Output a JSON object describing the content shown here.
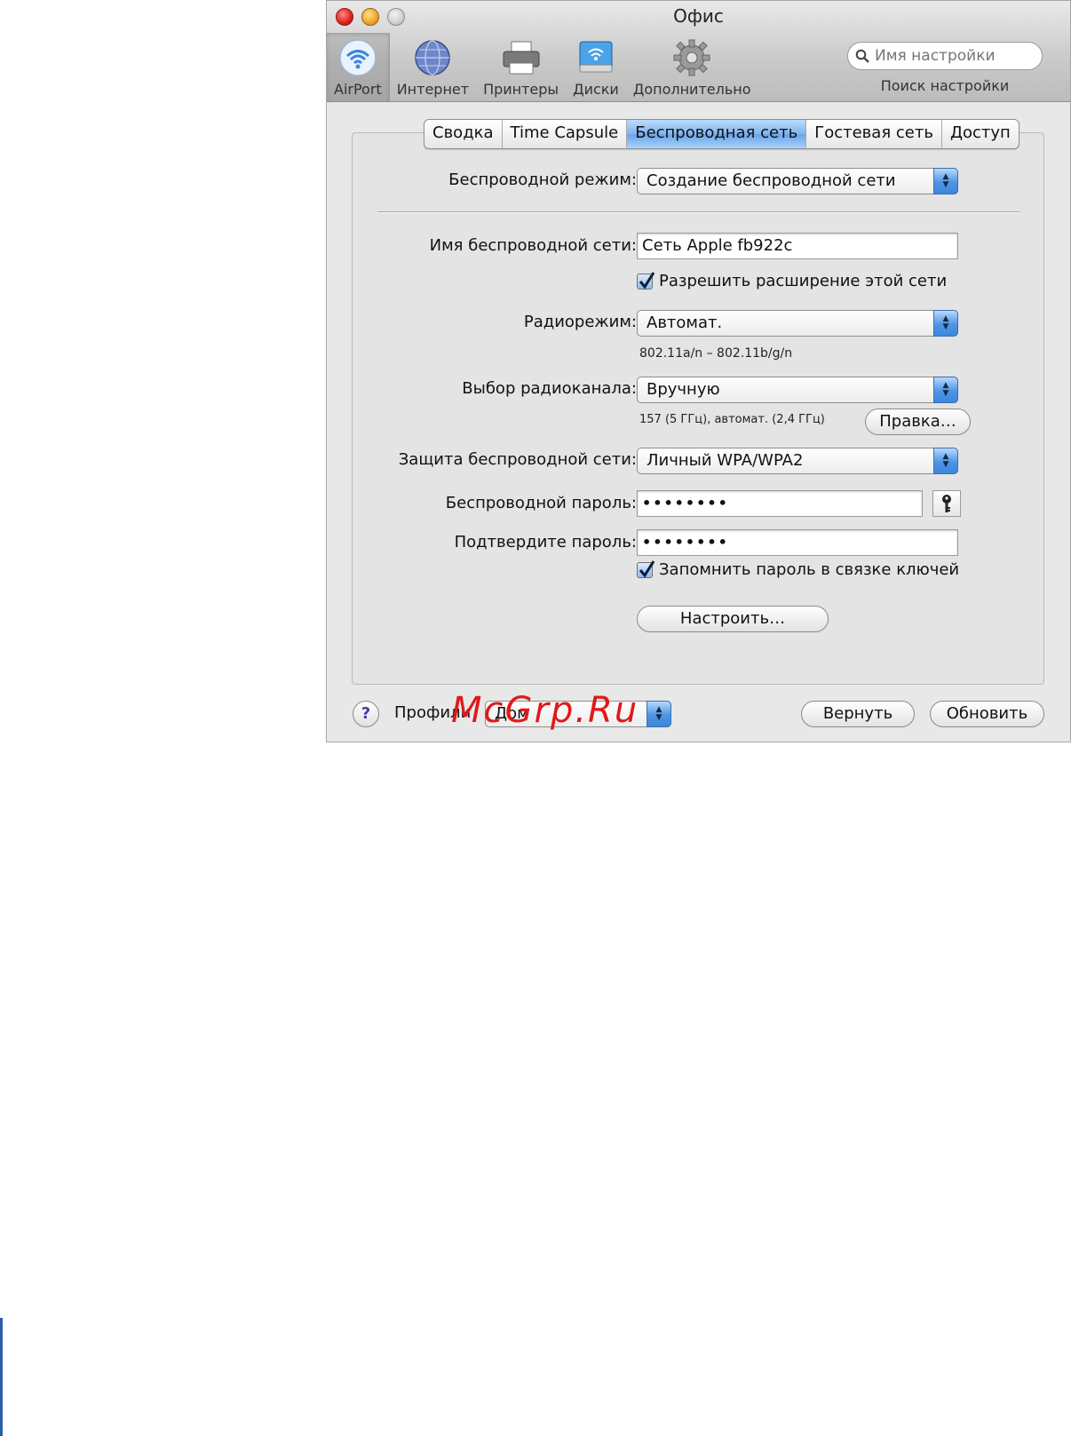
{
  "window": {
    "title": "Офис"
  },
  "toolbar": {
    "items": [
      {
        "label": "AirPort",
        "icon": "airport-wifi-icon",
        "selected": true
      },
      {
        "label": "Интернет",
        "icon": "globe-icon"
      },
      {
        "label": "Принтеры",
        "icon": "printer-icon"
      },
      {
        "label": "Диски",
        "icon": "disk-icon"
      },
      {
        "label": "Дополнительно",
        "icon": "gear-icon"
      }
    ]
  },
  "search": {
    "placeholder": "Имя настройки",
    "caption": "Поиск настройки"
  },
  "tabs": [
    {
      "label": "Сводка"
    },
    {
      "label": "Time Capsule"
    },
    {
      "label": "Беспроводная сеть",
      "active": true
    },
    {
      "label": "Гостевая сеть"
    },
    {
      "label": "Доступ"
    }
  ],
  "form": {
    "wireless_mode_label": "Беспроводной режим:",
    "wireless_mode_value": "Создание беспроводной сети",
    "network_name_label": "Имя беспроводной сети:",
    "network_name_value": "Сеть Apple fb922c",
    "allow_extend_label": "Разрешить расширение этой сети",
    "radio_mode_label": "Радиорежим:",
    "radio_mode_value": "Автомат.",
    "radio_mode_hint": "802.11a/n – 802.11b/g/n",
    "channel_label": "Выбор радиоканала:",
    "channel_value": "Вручную",
    "channel_hint": "157 (5 ГГц), автомат. (2,4 ГГц)",
    "channel_edit_button": "Правка…",
    "security_label": "Защита беспроводной сети:",
    "security_value": "Личный WPA/WPA2",
    "password_label": "Беспроводной пароль:",
    "password_value": "••••••••",
    "confirm_label": "Подтвердите пароль:",
    "confirm_value": "••••••••",
    "keychain_label": "Запомнить пароль в связке ключей",
    "configure_button": "Настроить…"
  },
  "bottom": {
    "help": "?",
    "profile_label": "Профили",
    "profile_value": "Дом",
    "revert_button": "Вернуть",
    "update_button": "Обновить",
    "watermark": "McGrp.Ru"
  },
  "colors": {
    "accent": "#5b9ee8",
    "watermark": "#e01919"
  }
}
